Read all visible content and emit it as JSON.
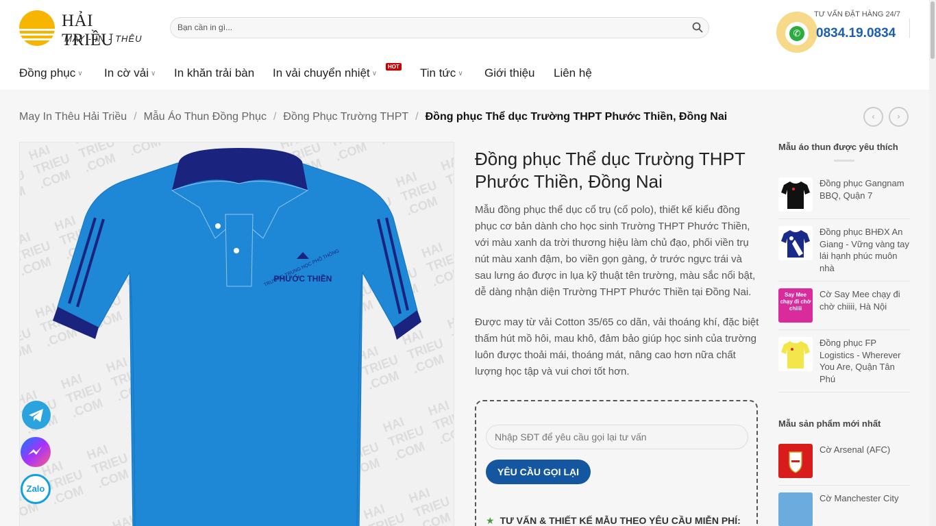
{
  "header": {
    "logo_title": "HẢI TRIỀU",
    "logo_subtitle": "MAY - IN - THÊU",
    "search_placeholder": "Bạn cần in gì...",
    "hotline_label": "TƯ VẤN ĐẶT HÀNG 24/7",
    "hotline_number": "0834.19.0834"
  },
  "nav": {
    "items": [
      {
        "label": "Đồng phục"
      },
      {
        "label": "In cờ vải"
      },
      {
        "label": "In khăn trải bàn"
      },
      {
        "label": "In vải chuyển nhiệt"
      },
      {
        "label": "Tin tức"
      },
      {
        "label": "Giới thiệu"
      },
      {
        "label": "Liên hệ"
      }
    ],
    "hot_badge": "HOT"
  },
  "breadcrumb": {
    "items": [
      "May In Thêu Hải Triều",
      "Mẫu Áo Thun Đồng Phục",
      "Đồng Phục Trường THPT"
    ],
    "current": "Đồng phục Thể dục Trường THPT Phước Thiền, Đồng Nai",
    "separator": "/"
  },
  "product": {
    "title": "Đồng phục Thể dục Trường THPT Phước Thiền, Đồng Nai",
    "desc1": "Mẫu đồng phục thể dục cổ trụ (cổ polo), thiết kế kiểu đồng phục cơ bản dành cho học sinh Trường THPT Phước Thiền, với màu xanh da trời thương hiệu làm chủ đạo, phối viền trụ nút màu xanh đậm, bo viền gọn gàng, ở trước ngực trái và sau lưng áo được in lụa kỹ thuật tên trường, màu sắc nổi bật, dễ dàng nhận diện Trường THPT Phước Thiền tại Đồng Nai.",
    "desc2": "Được may từ vải Cotton 35/65 co dãn, vải thoáng khí, đặc biệt thấm hút mồ hôi, mau khô, đảm bảo giúp học sinh của trường luôn được thoải mái, thoáng mát, nâng cao hơn nữa chất lượng học tập và vui chơi tốt hơn.",
    "shirt_print_top": "TRƯỜNG TRUNG HỌC PHỔ THÔNG",
    "shirt_print_name": "PHƯỚC THIỀN",
    "watermark": "HAI TRIEU .COM",
    "shirt_color": "#1e88d6",
    "trim_color": "#1a237e"
  },
  "callback": {
    "placeholder": "Nhập SĐT để yêu cầu gọi lại tư vấn",
    "button": "YÊU CẦU GỌI LẠI",
    "free_line": "TƯ VẤN & THIẾT KẾ MẪU THEO YÊU CẦU MIỄN PHÍ:"
  },
  "sidebar": {
    "favorite_title": "Mẫu áo thun được yêu thích",
    "favorites": [
      {
        "name": "Đồng phục Gangnam BBQ, Quận 7"
      },
      {
        "name": "Đồng phục BHĐX An Giang - Vững vàng tay lái hạnh phúc muôn nhà"
      },
      {
        "name": "Cờ Say Mee chạy đi chờ chiiii, Hà Nội",
        "thumb_text": "Say Mee chạy đi chờ chiiii"
      },
      {
        "name": "Đồng phục FP Logistics - Wherever You Are, Quận Tân Phú"
      }
    ],
    "latest_title": "Mẫu sản phẩm mới nhất",
    "latest": [
      {
        "name": "Cờ Arsenal (AFC)"
      },
      {
        "name": "Cờ Manchester City"
      }
    ]
  },
  "social": {
    "zalo": "Zalo"
  }
}
